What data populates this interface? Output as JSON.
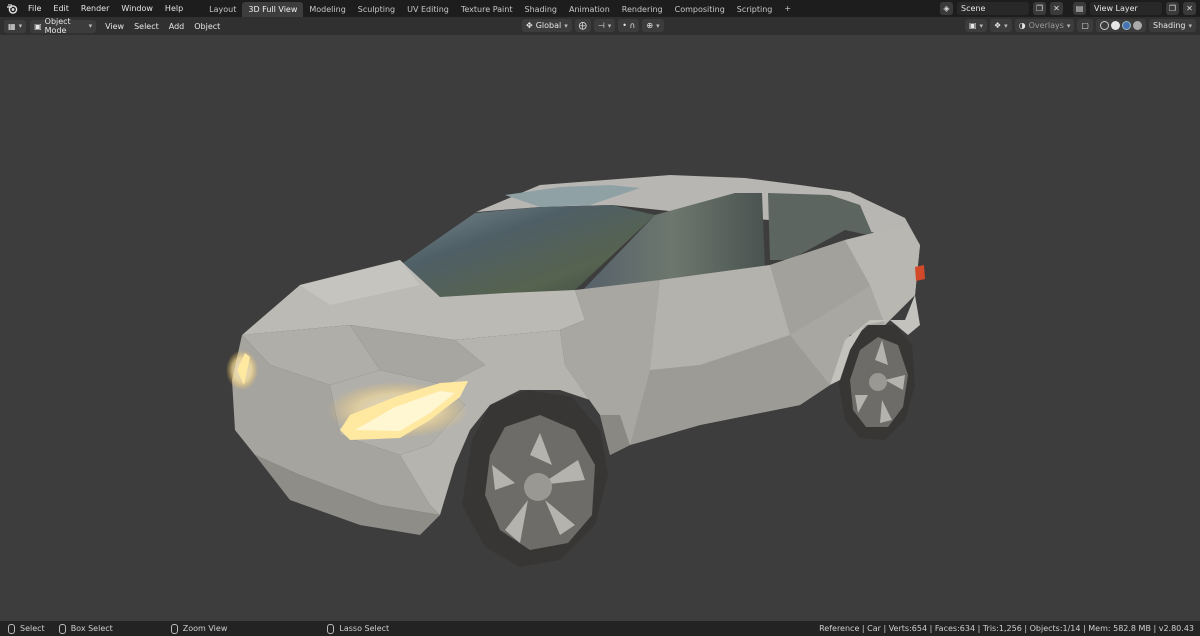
{
  "topbar": {
    "menus": [
      "File",
      "Edit",
      "Render",
      "Window",
      "Help"
    ],
    "workspaces": [
      "Layout",
      "3D Full View",
      "Modeling",
      "Sculpting",
      "UV Editing",
      "Texture Paint",
      "Shading",
      "Animation",
      "Rendering",
      "Compositing",
      "Scripting"
    ],
    "active_workspace": "3D Full View",
    "add_tab": "+",
    "scene": "Scene",
    "view_layer": "View Layer"
  },
  "header": {
    "mode": "Object Mode",
    "menus": [
      "View",
      "Select",
      "Add",
      "Object"
    ],
    "transform_orientation": "Global",
    "overlays": "Overlays",
    "shading": "Shading"
  },
  "status": {
    "select": "Select",
    "box_select": "Box Select",
    "zoom_view": "Zoom View",
    "lasso_select": "Lasso Select",
    "stats": "Reference | Car | Verts:654 | Faces:634 | Tris:1,256 | Objects:1/14 | Mem: 582.8 MB | v2.80.43"
  },
  "colors": {
    "background": "#3d3d3d",
    "topbar": "#1d1d1d",
    "header": "#303030",
    "car_body": "#c2c0bb",
    "headlight": "#ffe9a8",
    "taillight": "#d24a2a",
    "tire": "#383634"
  },
  "icons": [
    "blender-logo-icon",
    "editor-type-icon",
    "object-mode-icon",
    "transform-icon",
    "snap-icon",
    "proportional-icon",
    "scene-icon",
    "view-layer-icon",
    "overlay-icon",
    "shading-solid-icon",
    "mouse-icon"
  ]
}
